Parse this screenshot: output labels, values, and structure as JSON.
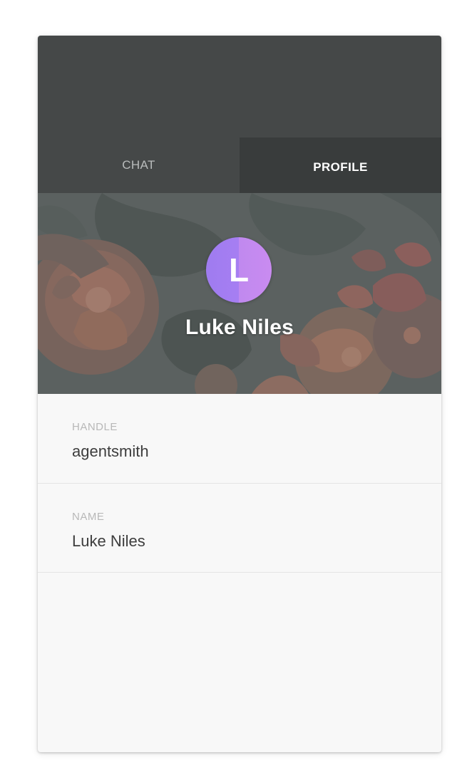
{
  "tabs": [
    {
      "label": "CHAT",
      "active": false
    },
    {
      "label": "PROFILE",
      "active": true
    }
  ],
  "profile": {
    "avatar_initial": "L",
    "name": "Luke Niles"
  },
  "fields": [
    {
      "label": "HANDLE",
      "value": "agentsmith"
    },
    {
      "label": "NAME",
      "value": "Luke Niles"
    }
  ],
  "colors": {
    "header_bg": "#454848",
    "active_tab_bg": "#393c3c",
    "avatar_gradient_start": "#9f7cf0",
    "avatar_gradient_end": "#c98bf0",
    "card_bg": "#f8f8f8"
  },
  "icons": {
    "hero_background": "floral-background-image"
  }
}
